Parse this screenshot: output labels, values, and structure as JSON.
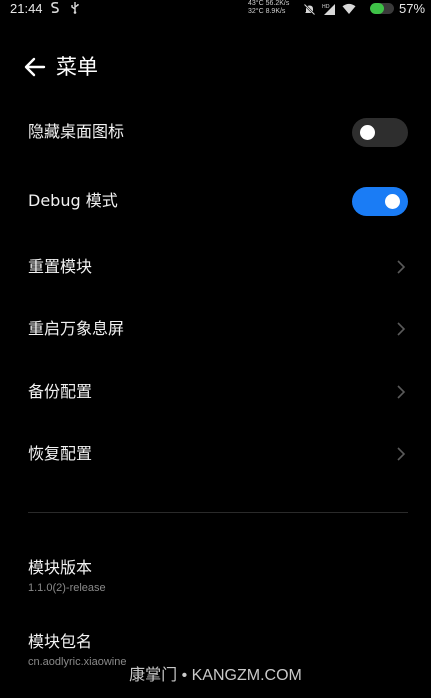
{
  "status_bar": {
    "time": "21:44",
    "stats_line1": "43°C  56.2K/s",
    "stats_line2": "32°C  8.9K/s",
    "battery_level": 0.57,
    "battery_percent": "57%",
    "battery_color": "#3ec247"
  },
  "header": {
    "title": "菜单",
    "back_icon": "arrow-left-icon"
  },
  "settings": {
    "hide_icon": {
      "label": "隐藏桌面图标",
      "enabled": false
    },
    "debug_mode": {
      "label": "Debug 模式",
      "enabled": true
    },
    "reset_module": {
      "label": "重置模块"
    },
    "restart_aod": {
      "label": "重启万象息屏"
    },
    "backup_config": {
      "label": "备份配置"
    },
    "restore_config": {
      "label": "恢复配置"
    }
  },
  "info": {
    "module_version": {
      "title": "模块版本",
      "value": "1.1.0(2)-release"
    },
    "package_name": {
      "title": "模块包名",
      "value": "cn.aodlyric.xiaowine"
    }
  },
  "watermark": "康掌门 • KANGZM.COM",
  "colors": {
    "accent": "#1a7cf5",
    "background": "#000000"
  }
}
